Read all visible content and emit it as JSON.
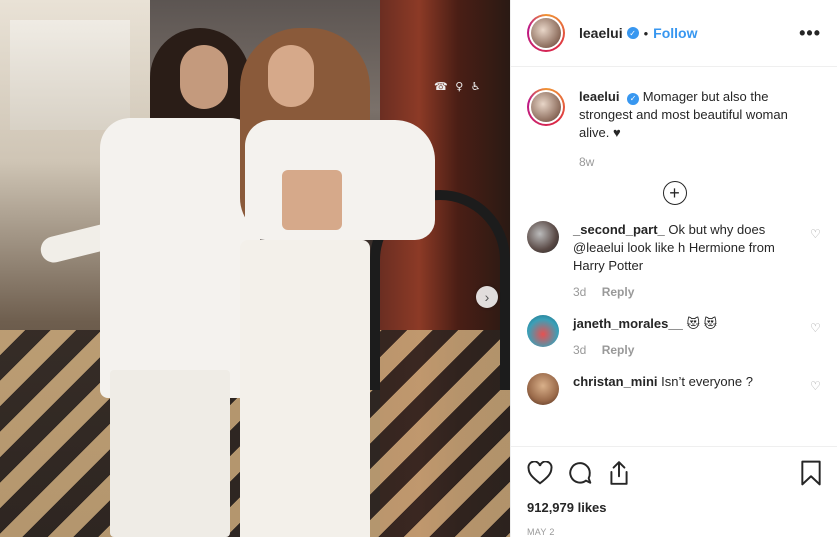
{
  "post": {
    "username": "leaelui",
    "header_dot": "•",
    "follow_label": "Follow",
    "more_label": "•••",
    "caption": {
      "username": "leaelui",
      "text": "Momager but also the strongest and most beautiful woman alive. ♥",
      "age": "8w"
    },
    "load_more_label": "+",
    "comments": [
      {
        "username": "_second_part_",
        "text": "Ok but why does @leaelui look like h Hermione from Harry Potter",
        "age": "3d",
        "reply_label": "Reply",
        "avatar_color": "#5a4a46"
      },
      {
        "username": "janeth_morales__",
        "text": "😻 😻",
        "age": "3d",
        "reply_label": "Reply",
        "avatar_color": "#3aa0b8"
      },
      {
        "username": "christan_mini",
        "text": "Isn’t everyone ?",
        "age": "",
        "reply_label": "",
        "avatar_color": "#9a6a4a"
      }
    ],
    "likes": "912,979 likes",
    "date": "MAY 2",
    "photo_sign": "☎ ♀ ♿",
    "carousel_next": "›"
  },
  "colors": {
    "accent": "#3897f0",
    "text": "#262626",
    "muted": "#999999",
    "border": "#efefef"
  },
  "icons": [
    "heart-icon",
    "comment-icon",
    "share-icon",
    "bookmark-icon",
    "verified-icon",
    "more-icon",
    "plus-circle-icon",
    "chevron-right-icon"
  ]
}
